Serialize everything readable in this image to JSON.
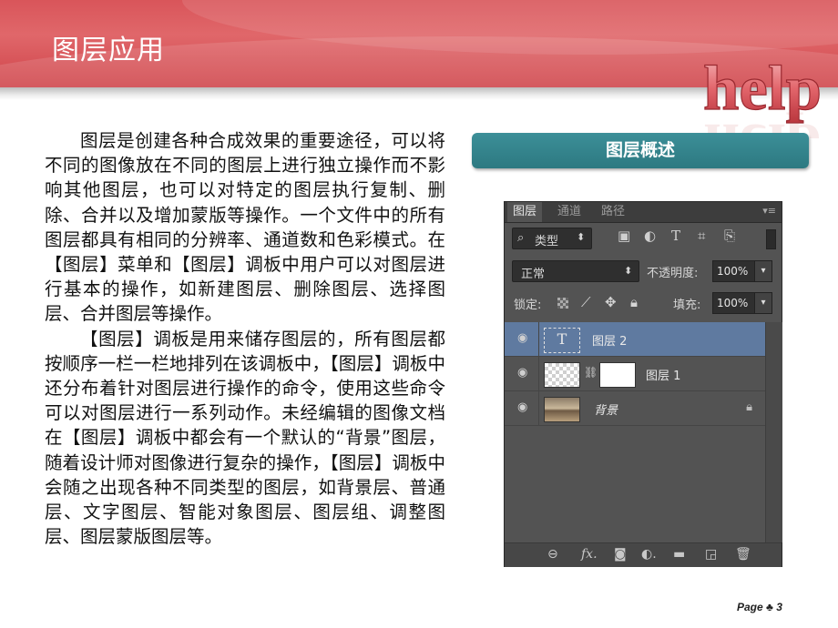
{
  "slide": {
    "title": "图层应用",
    "logo_text": "help",
    "section_tag": "图层概述",
    "paragraphs": [
      "图层是创建各种合成效果的重要途径，可以将不同的图像放在不同的图层上进行独立操作而不影响其他图层，也可以对特定的图层执行复制、删除、合并以及增加蒙版等操作。一个文件中的所有图层都具有相同的分辨率、通道数和色彩模式。在【图层】菜单和【图层】调板中用户可以对图层进行基本的操作，如新建图层、删除图层、选择图层、合并图层等操作。",
      "【图层】调板是用来储存图层的，所有图层都按顺序一栏一栏地排列在该调板中，【图层】调板中还分布着针对图层进行操作的命令，使用这些命令可以对图层进行一系列动作。未经编辑的图像文档在【图层】调板中都会有一个默认的“背景”图层，随着设计师对图像进行复杂的操作，【图层】调板中会随之出现各种不同类型的图层，如背景层、普通层、文字图层、智能对象图层、图层组、调整图层、图层蒙版图层等。"
    ],
    "page_label": "Page",
    "page_number": "3",
    "banner_color": "#d9555a",
    "tag_color": "#3c8f98"
  },
  "panel": {
    "tabs": [
      "图层",
      "通道",
      "路径"
    ],
    "active_tab": "图层",
    "menu_icon": "panel-menu-icon",
    "filter": {
      "search_glyph": "⌕",
      "label": "类型",
      "arrows": "⬍"
    },
    "filter_icons": [
      "image-filter-icon",
      "adjustment-filter-icon",
      "type-filter-icon",
      "shape-filter-icon",
      "smart-object-filter-icon"
    ],
    "blend_mode": "正常",
    "opacity_label": "不透明度:",
    "opacity_value": "100%",
    "lock_label": "锁定:",
    "fill_label": "填充:",
    "fill_value": "100%",
    "layers": [
      {
        "name": "图层 2",
        "kind": "type",
        "thumb_glyph": "T",
        "selected": true
      },
      {
        "name": "图层 1",
        "kind": "masked",
        "selected": false
      },
      {
        "name": "背景",
        "kind": "background",
        "selected": false,
        "locked": true
      }
    ],
    "footer_icons": [
      "link-layers-icon",
      "fx-icon",
      "add-mask-icon",
      "adjustment-layer-icon",
      "new-group-icon",
      "new-layer-icon",
      "delete-icon"
    ],
    "selected_color": "#5f7aa0",
    "panel_color": "#535353"
  }
}
